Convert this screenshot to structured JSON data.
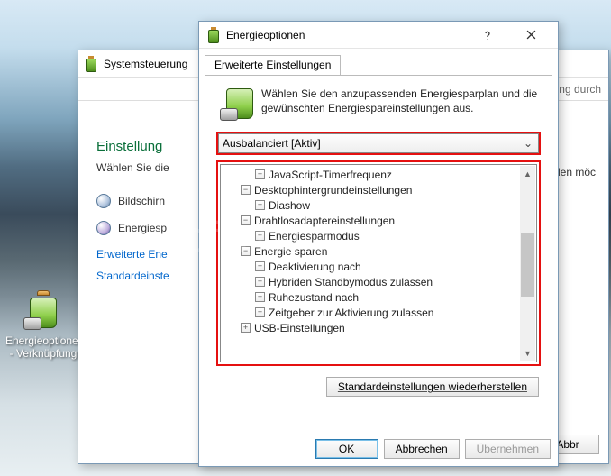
{
  "shortcut": {
    "label": "Energieoptionen - Verknüpfung"
  },
  "bg_window": {
    "title": "Systemsteuerung",
    "search_hint": "rung durch",
    "heading": "Einstellung",
    "description": "Wählen Sie die",
    "row1": "Bildschirn",
    "row2": "Energiesp",
    "link1": "Erweiterte Ene",
    "link2": "Standardeinste",
    "right_desc": "nden möc",
    "btn_abbr": "Abbr"
  },
  "dialog": {
    "title": "Energieoptionen",
    "tab": "Erweiterte Einstellungen",
    "intro": "Wählen Sie den anzupassenden Energiesparplan und die gewünschten Energiespareinstellungen aus.",
    "combo": "Ausbalanciert [Aktiv]",
    "tree": [
      {
        "indent": 2,
        "exp": "+",
        "label": "JavaScript-Timerfrequenz"
      },
      {
        "indent": 1,
        "exp": "−",
        "label": "Desktophintergrundeinstellungen"
      },
      {
        "indent": 2,
        "exp": "+",
        "label": "Diashow"
      },
      {
        "indent": 1,
        "exp": "−",
        "label": "Drahtlosadaptereinstellungen"
      },
      {
        "indent": 2,
        "exp": "+",
        "label": "Energiesparmodus"
      },
      {
        "indent": 1,
        "exp": "−",
        "label": "Energie sparen"
      },
      {
        "indent": 2,
        "exp": "+",
        "label": "Deaktivierung nach"
      },
      {
        "indent": 2,
        "exp": "+",
        "label": "Hybriden Standbymodus zulassen"
      },
      {
        "indent": 2,
        "exp": "+",
        "label": "Ruhezustand nach"
      },
      {
        "indent": 2,
        "exp": "+",
        "label": "Zeitgeber zur Aktivierung zulassen"
      },
      {
        "indent": 1,
        "exp": "+",
        "label": "USB-Einstellungen"
      }
    ],
    "restore": "Standardeinstellungen wiederherstellen",
    "ok": "OK",
    "cancel": "Abbrechen",
    "apply": "Übernehmen"
  },
  "watermark": "SoftwareOK.de"
}
